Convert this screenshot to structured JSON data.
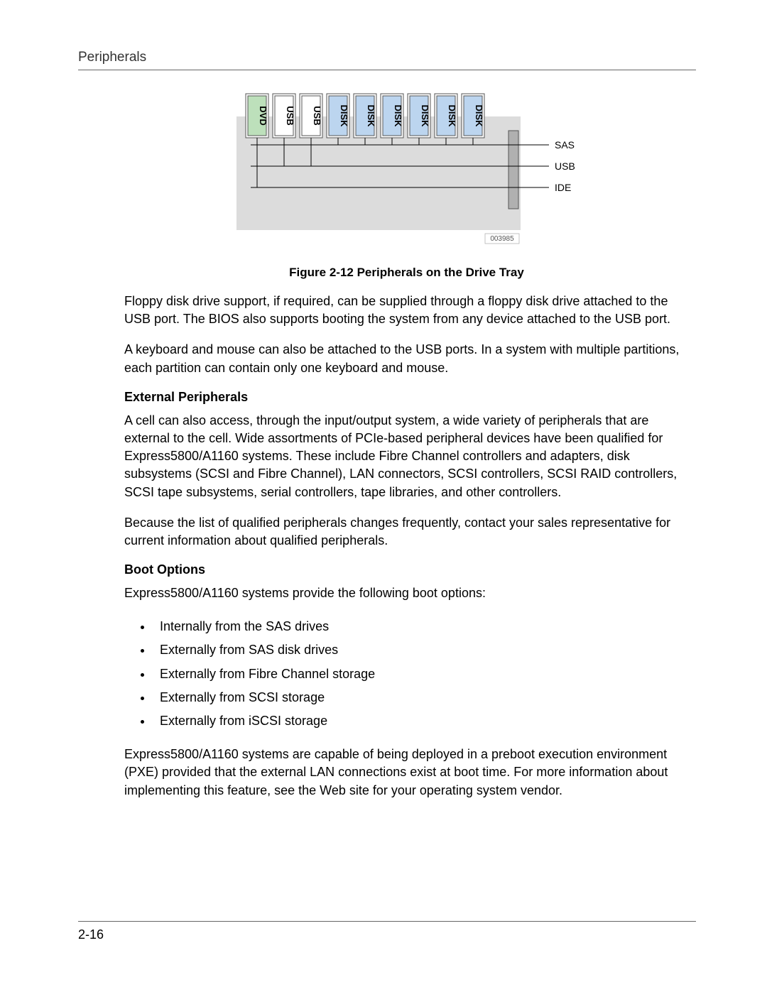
{
  "header": {
    "section_title": "Peripherals"
  },
  "figure": {
    "caption": "Figure 2-12 Peripherals on the Drive Tray",
    "id_label": "003985",
    "slots": [
      {
        "label": "DVD",
        "fill": "#bde0bb"
      },
      {
        "label": "USB",
        "fill": "#ffffff"
      },
      {
        "label": "USB",
        "fill": "#ffffff"
      },
      {
        "label": "DISK",
        "fill": "#bcd5ef"
      },
      {
        "label": "DISK",
        "fill": "#bcd5ef"
      },
      {
        "label": "DISK",
        "fill": "#bcd5ef"
      },
      {
        "label": "DISK",
        "fill": "#bcd5ef"
      },
      {
        "label": "DISK",
        "fill": "#bcd5ef"
      },
      {
        "label": "DISK",
        "fill": "#bcd5ef"
      }
    ],
    "bus_labels": {
      "sas": "SAS",
      "usb": "USB",
      "ide": "IDE"
    }
  },
  "paragraphs": {
    "p1": "Floppy disk drive support, if required, can be supplied through a floppy disk drive attached to the USB port. The BIOS also supports booting the system from any device attached to the USB port.",
    "p2": " A keyboard and mouse can also be attached to the USB ports. In a system with multiple partitions, each partition can contain only one keyboard and mouse.",
    "ext_head": "External Peripherals",
    "p3": "A cell can also access, through the input/output system, a wide variety of peripherals that are external to the cell. Wide assortments of PCIe-based peripheral devices have been qualified for Express5800/A1160 systems. These include Fibre Channel controllers and adapters, disk subsystems (SCSI and Fibre Channel), LAN connectors, SCSI controllers, SCSI RAID controllers, SCSI tape subsystems, serial controllers, tape libraries, and other controllers.",
    "p4": "Because the list of qualified peripherals changes frequently, contact your sales representative for current information about qualified peripherals.",
    "boot_head": "Boot Options",
    "p5": "Express5800/A1160 systems provide the following boot options:",
    "boot_items": [
      "Internally from the SAS drives",
      "Externally from SAS disk drives",
      "Externally from Fibre Channel storage",
      "Externally from SCSI storage",
      "Externally from iSCSI storage"
    ],
    "p6": "Express5800/A1160 systems are capable of being deployed in a preboot execution environment (PXE) provided that the external LAN connections exist at boot time. For more information about implementing this feature, see the Web site for your operating system vendor."
  },
  "footer": {
    "page_number": "2-16"
  }
}
